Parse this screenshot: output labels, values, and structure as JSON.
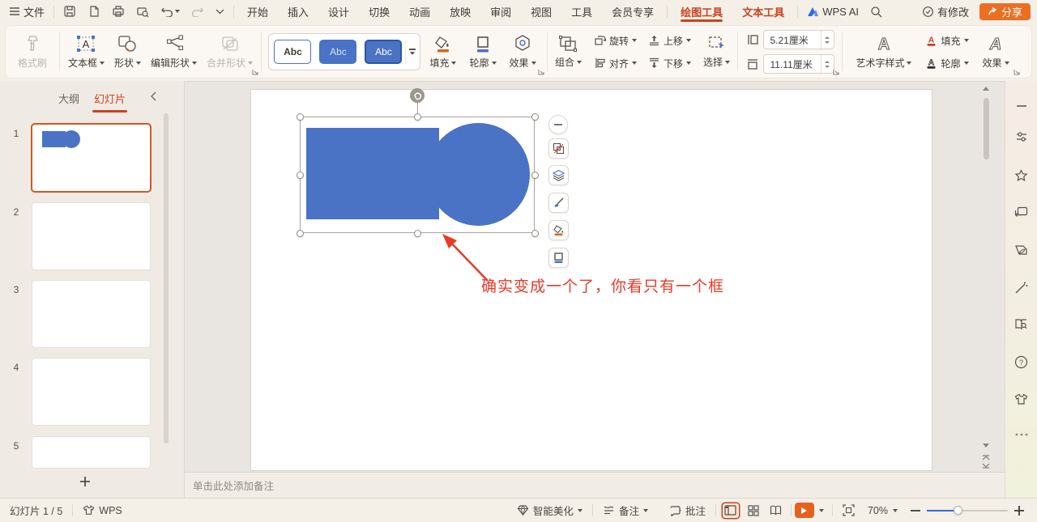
{
  "colors": {
    "accent_orange": "#c8441f",
    "share_button_orange": "#ec6e22",
    "shape_blue": "#4a73c6",
    "annotation_red": "#e83a28",
    "zoom_slider_blue": "#2f6be0"
  },
  "titlebar": {
    "file": "文件",
    "tabs": [
      "开始",
      "插入",
      "设计",
      "切换",
      "动画",
      "放映",
      "审阅",
      "视图",
      "工具",
      "会员专享"
    ],
    "tool_tabs": [
      "绘图工具",
      "文本工具"
    ],
    "wps_ai": "WPS AI",
    "modified": "有修改",
    "share": "分享"
  },
  "ribbon": {
    "format_painter": "格式刷",
    "text_box": "文本框",
    "shapes": "形状",
    "edit_shape": "编辑形状",
    "merge_shapes": "合并形状",
    "styles": [
      "Abc",
      "Abc",
      "Abc"
    ],
    "fill": "填充",
    "outline": "轮廓",
    "effect": "效果",
    "group": "组合",
    "rotate": "旋转",
    "move_up": "上移",
    "align": "对齐",
    "move_down": "下移",
    "select": "选择",
    "height": "5.21厘米",
    "width": "11.11厘米",
    "wordart": "艺术字样式",
    "text_fill": "填充",
    "text_outline": "轮廓",
    "text_effect": "效果"
  },
  "sidebar": {
    "outline_tab": "大纲",
    "slides_tab": "幻灯片",
    "slides": [
      {
        "num": "1"
      },
      {
        "num": "2"
      },
      {
        "num": "3"
      },
      {
        "num": "4"
      },
      {
        "num": "5"
      }
    ]
  },
  "canvas": {
    "annotation": "确实变成一个了，你看只有一个框"
  },
  "notes": {
    "placeholder": "单击此处添加备注"
  },
  "statusbar": {
    "slide_counter": "幻灯片 1 / 5",
    "wps": "WPS",
    "beautify": "智能美化",
    "notes": "备注",
    "comments": "批注",
    "zoom": "70%"
  }
}
